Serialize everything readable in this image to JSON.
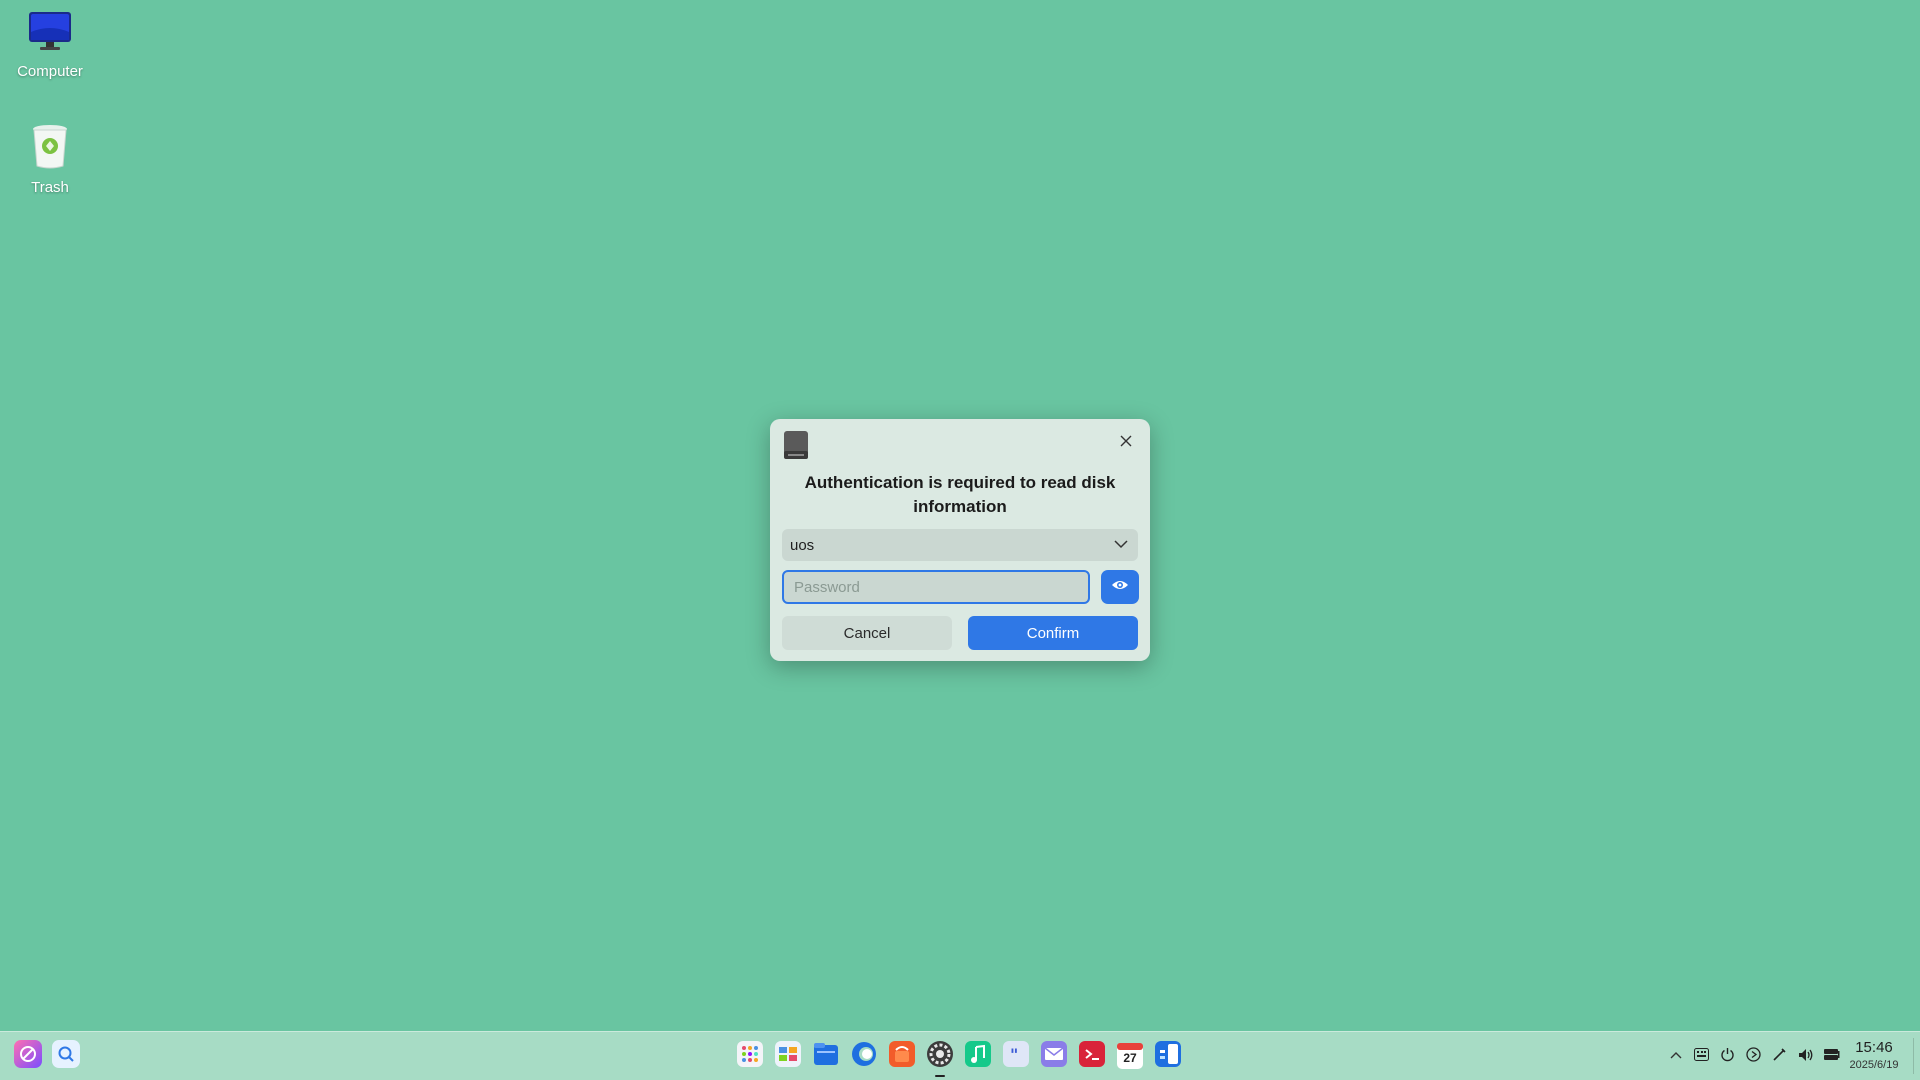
{
  "desktop": {
    "icons": [
      {
        "label": "Computer",
        "icon": "computer-icon"
      },
      {
        "label": "Trash",
        "icon": "trash-icon"
      }
    ]
  },
  "dialog": {
    "app_icon": "disk-icon",
    "title": "Authentication is required to read disk information",
    "user_select": {
      "value": "uos",
      "icon": "chevron-down-icon"
    },
    "password": {
      "placeholder": "Password",
      "value": ""
    },
    "reveal_icon": "eye-icon",
    "cancel_label": "Cancel",
    "confirm_label": "Confirm",
    "accent_color": "#2f78e6"
  },
  "taskbar": {
    "left_apps": [
      "deepin-launcher-icon",
      "search-icon"
    ],
    "apps": [
      {
        "name": "launcher",
        "icon": "launcher-grid-icon"
      },
      {
        "name": "multitasking",
        "icon": "multitask-icon"
      },
      {
        "name": "file-manager",
        "icon": "folder-icon"
      },
      {
        "name": "browser",
        "icon": "browser-icon"
      },
      {
        "name": "app-store",
        "icon": "store-icon"
      },
      {
        "name": "control-center",
        "icon": "gear-icon",
        "running": true
      },
      {
        "name": "music",
        "icon": "music-icon"
      },
      {
        "name": "chat",
        "icon": "chat-icon"
      },
      {
        "name": "mail",
        "icon": "mail-icon"
      },
      {
        "name": "terminal",
        "icon": "terminal-icon"
      },
      {
        "name": "calendar",
        "icon": "calendar-icon",
        "badge": "27"
      },
      {
        "name": "system-monitor",
        "icon": "monitor-icon"
      }
    ],
    "tray": [
      "chevron-up-icon",
      "keyboard-icon",
      "power-icon",
      "media-icon",
      "pen-icon",
      "volume-icon",
      "battery-icon"
    ],
    "clock": {
      "time": "15:46",
      "date": "2025/6/19"
    }
  }
}
